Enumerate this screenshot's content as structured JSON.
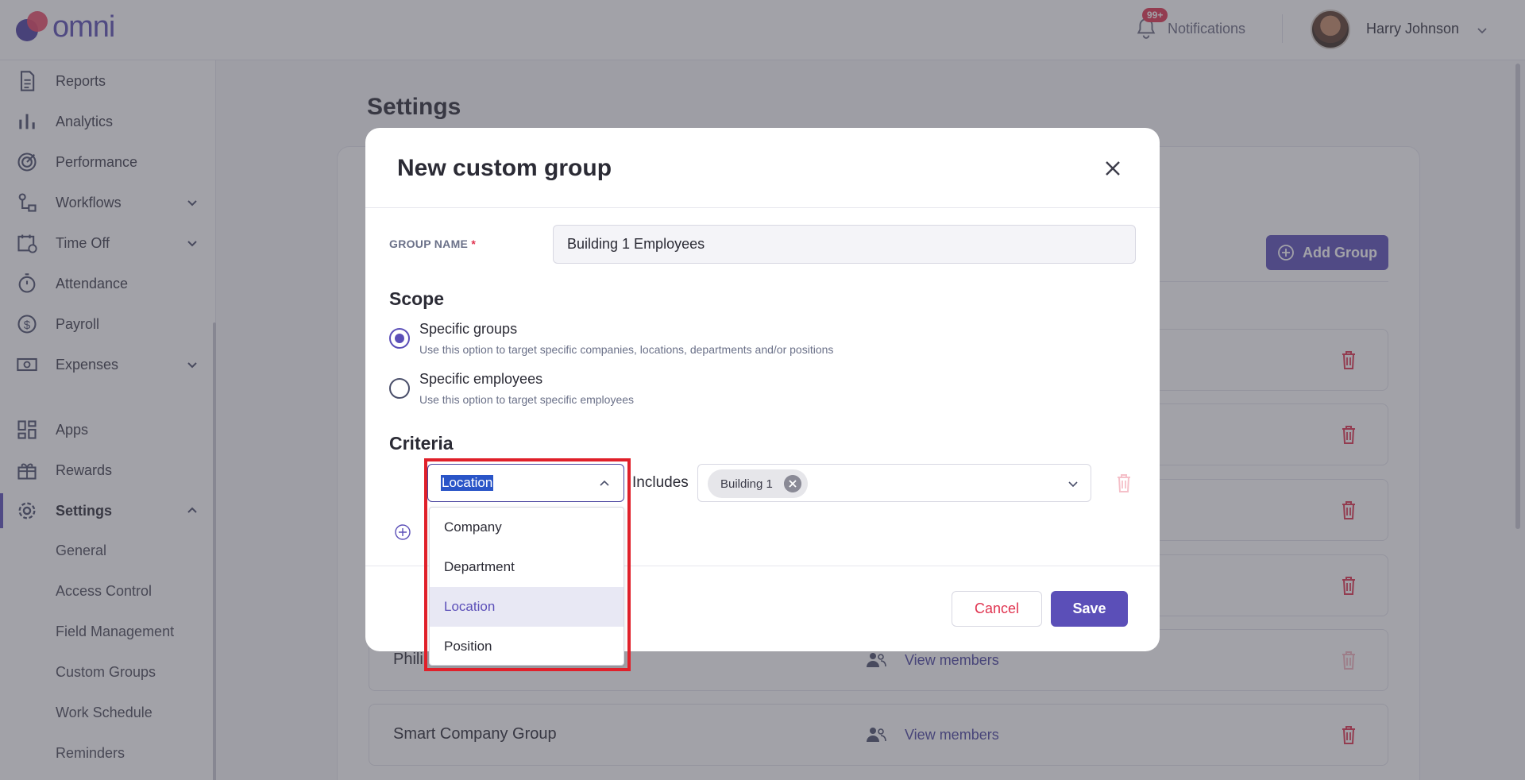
{
  "app": {
    "logo_text": "omni"
  },
  "header": {
    "notifications_badge": "99+",
    "notifications_label": "Notifications",
    "user_name": "Harry Johnson"
  },
  "sidebar": {
    "items": [
      {
        "label": "Reports",
        "icon": "document-icon"
      },
      {
        "label": "Analytics",
        "icon": "bar-chart-icon"
      },
      {
        "label": "Performance",
        "icon": "target-icon"
      },
      {
        "label": "Workflows",
        "icon": "workflow-icon"
      },
      {
        "label": "Time Off",
        "icon": "calendar-clock-icon"
      },
      {
        "label": "Attendance",
        "icon": "stopwatch-icon"
      },
      {
        "label": "Payroll",
        "icon": "dollar-circle-icon"
      },
      {
        "label": "Expenses",
        "icon": "money-icon"
      },
      {
        "label": "Apps",
        "icon": "grid-icon"
      },
      {
        "label": "Rewards",
        "icon": "gift-icon"
      },
      {
        "label": "Settings",
        "icon": "gear-icon"
      }
    ],
    "settings_sub": [
      "General",
      "Access Control",
      "Field Management",
      "Custom Groups",
      "Work Schedule",
      "Reminders"
    ]
  },
  "main": {
    "page_title": "Settings",
    "add_group_label": "Add Group",
    "groups": [
      {
        "name": "Phili",
        "members_label": "View members"
      },
      {
        "name": "Smart Company Group",
        "members_label": "View members"
      }
    ]
  },
  "modal": {
    "title": "New custom group",
    "group_name_label": "GROUP NAME",
    "group_name_required": "*",
    "group_name_value": "Building 1 Employees",
    "scope_heading": "Scope",
    "scope_options": [
      {
        "title": "Specific groups",
        "desc": "Use this option to target specific companies, locations, departments and/or positions",
        "checked": true
      },
      {
        "title": "Specific employees",
        "desc": "Use this option to target specific employees",
        "checked": false
      }
    ],
    "criteria_heading": "Criteria",
    "criteria_field": "Location",
    "criteria_operator": "Includes",
    "criteria_values": [
      "Building 1"
    ],
    "dropdown_options": [
      "Company",
      "Department",
      "Location",
      "Position"
    ],
    "dropdown_selected": "Location",
    "cancel_label": "Cancel",
    "save_label": "Save"
  },
  "colors": {
    "accent": "#5b4fb8",
    "danger": "#e0334f",
    "highlight_box": "#e0202a"
  }
}
